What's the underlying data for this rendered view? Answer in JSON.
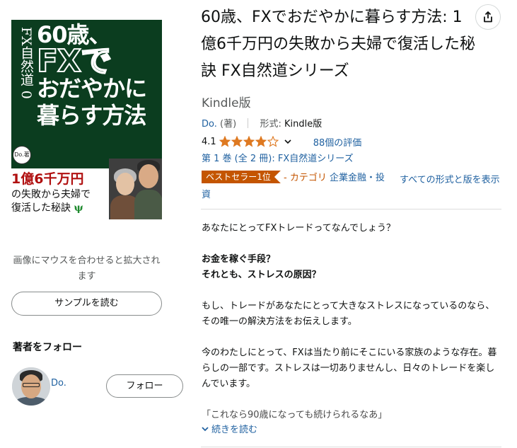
{
  "cover": {
    "series_vertical": "FX自然道 0",
    "title_lines": [
      "60歳、",
      "FXで",
      "おだやかに",
      "暮らす方法"
    ],
    "seal": "Do.著",
    "subtitle_red": "1億6千万円",
    "subtitle_line2": "の失敗から夫婦で",
    "subtitle_line3": "復活した秘訣"
  },
  "left": {
    "zoom_hint": "画像にマウスを合わせると拡大されます",
    "sample_button": "サンプルを読む",
    "follow_heading": "著者をフォロー",
    "author_name": "Do.",
    "follow_button": "フォロー"
  },
  "product": {
    "title": "60歳、FXでおだやかに暮らす方法: 1億6千万円の失敗から夫婦で復活した秘訣 FX自然道シリーズ",
    "format_label": "Kindle版",
    "author": "Do.",
    "author_role": "(著)",
    "format_key": "形式:",
    "format_value": "Kindle版",
    "rating": "4.1",
    "rating_stars": 4.1,
    "rating_count": "88個の評価",
    "series": "第 1 巻 (全 2 冊): FX自然道シリーズ",
    "badge": "ベストセラー1位",
    "badge_category_prefix": "- カテゴリ",
    "badge_category": "企業金融・投資",
    "all_formats": "すべての形式と版を表示"
  },
  "description": {
    "p1": "あなたにとってFXトレードってなんでしょう？",
    "p2_line1": "お金を稼ぐ手段？",
    "p2_line2": "それとも、ストレスの原因？",
    "p3": "もし、トレードがあなたにとって大きなストレスになっているのなら、その唯一の解決方法をお伝えします。",
    "p4": "今のわたしにとって、FXは当たり前にそこにいる家族のような存在。暮らしの一部です。ストレスは一切ありませんし、日々のトレードを楽しんでいます。",
    "p5": "「これなら90歳になっても続けられるなあ」",
    "read_more": "続きを読む"
  },
  "colors": {
    "link": "#2162a1",
    "badge": "#c45500",
    "star": "#de7921",
    "cover_bg": "#0b3d1f"
  }
}
